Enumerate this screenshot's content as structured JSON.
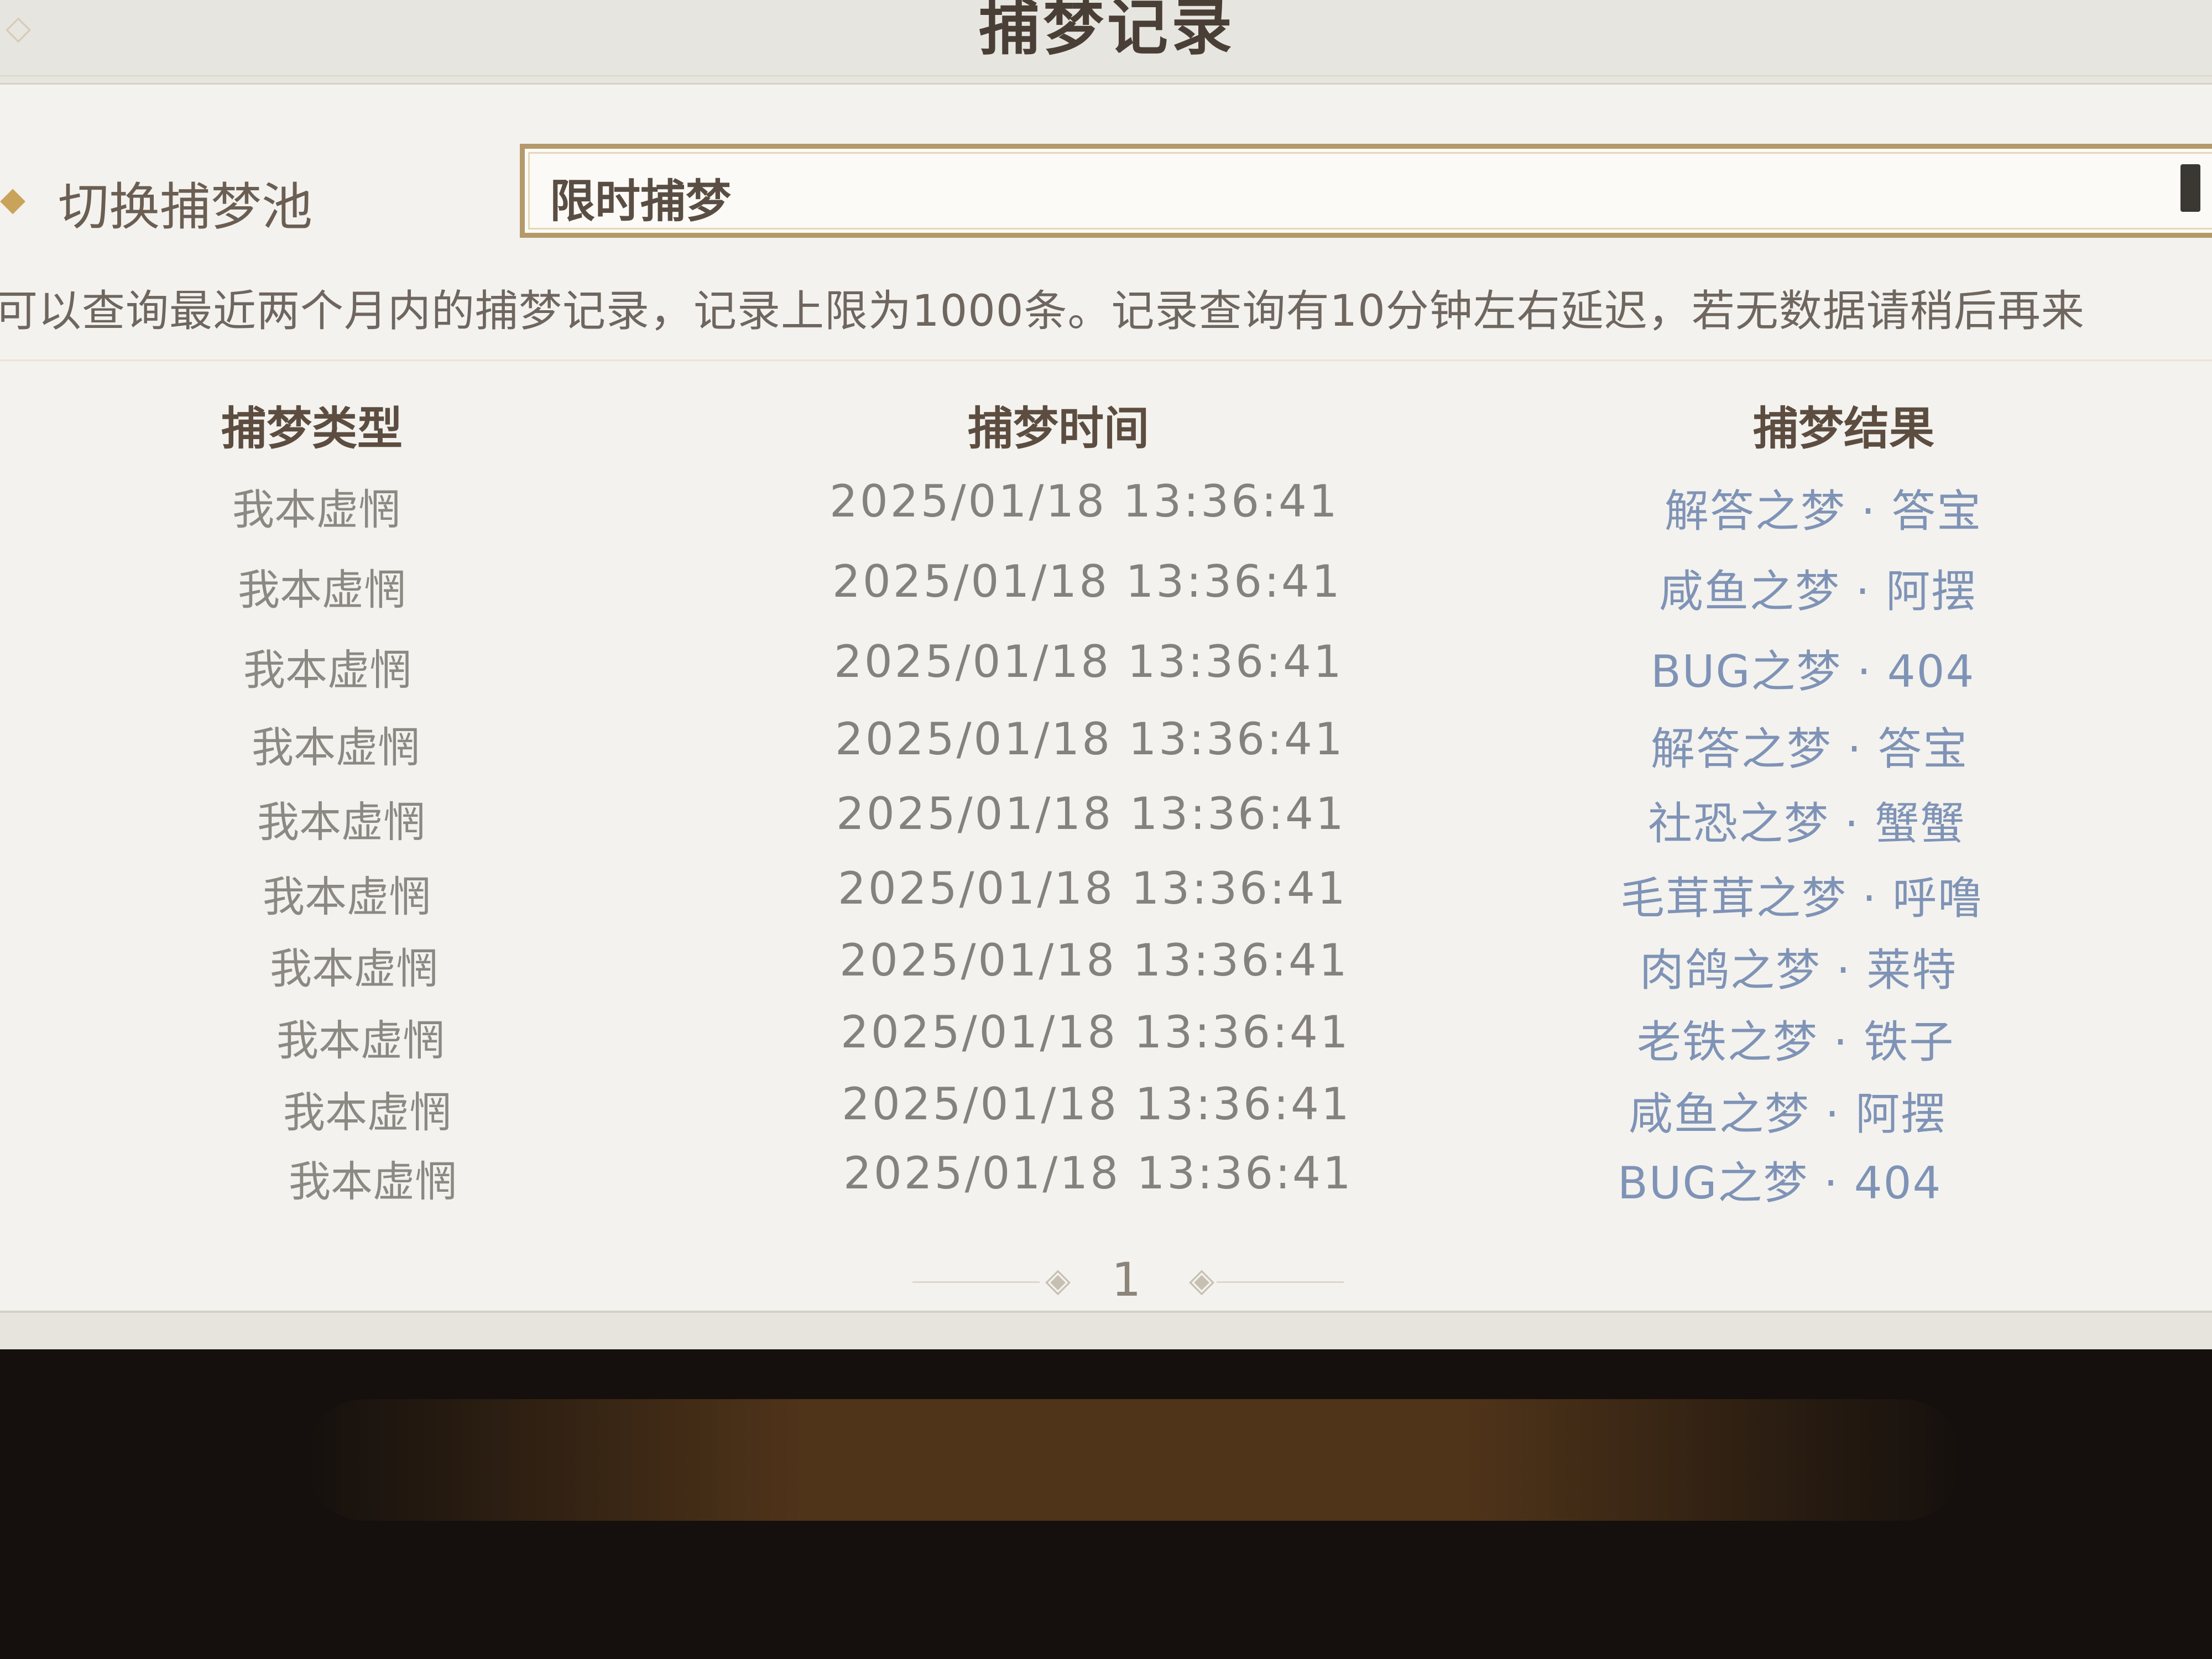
{
  "header": {
    "title": "捕梦记录"
  },
  "pool": {
    "label": "切换捕梦池",
    "selected": "限时捕梦"
  },
  "notice": "可以查询最近两个月内的捕梦记录，记录上限为1000条。记录查询有10分钟左右延迟，若无数据请稍后再来",
  "table": {
    "columns": [
      "捕梦类型",
      "捕梦时间",
      "捕梦结果"
    ],
    "rows": [
      {
        "type": "我本虚惘",
        "time": "2025/01/18 13:36:41",
        "result": "解答之梦 · 答宝"
      },
      {
        "type": "我本虚惘",
        "time": "2025/01/18 13:36:41",
        "result": "咸鱼之梦 · 阿摆"
      },
      {
        "type": "我本虚惘",
        "time": "2025/01/18 13:36:41",
        "result": "BUG之梦 · 404"
      },
      {
        "type": "我本虚惘",
        "time": "2025/01/18 13:36:41",
        "result": "解答之梦 · 答宝"
      },
      {
        "type": "我本虚惘",
        "time": "2025/01/18 13:36:41",
        "result": "社恐之梦 · 蟹蟹"
      },
      {
        "type": "我本虚惘",
        "time": "2025/01/18 13:36:41",
        "result": "毛茸茸之梦 · 呼噜"
      },
      {
        "type": "我本虚惘",
        "time": "2025/01/18 13:36:41",
        "result": "肉鸽之梦 · 莱特"
      },
      {
        "type": "我本虚惘",
        "time": "2025/01/18 13:36:41",
        "result": "老铁之梦 · 铁子"
      },
      {
        "type": "我本虚惘",
        "time": "2025/01/18 13:36:41",
        "result": "咸鱼之梦 · 阿摆"
      },
      {
        "type": "我本虚惘",
        "time": "2025/01/18 13:36:41",
        "result": "BUG之梦 · 404"
      }
    ]
  },
  "pagination": {
    "current_page": "1"
  },
  "icons": {
    "ornament": "diamond-ornament-icon",
    "prev": "pagination-prev-icon",
    "next": "pagination-next-icon",
    "dropdown": "dropdown-handle"
  },
  "colors": {
    "accent": "#b49a6a",
    "result_text": "#7f93b6",
    "title_text": "#4a3f36"
  }
}
